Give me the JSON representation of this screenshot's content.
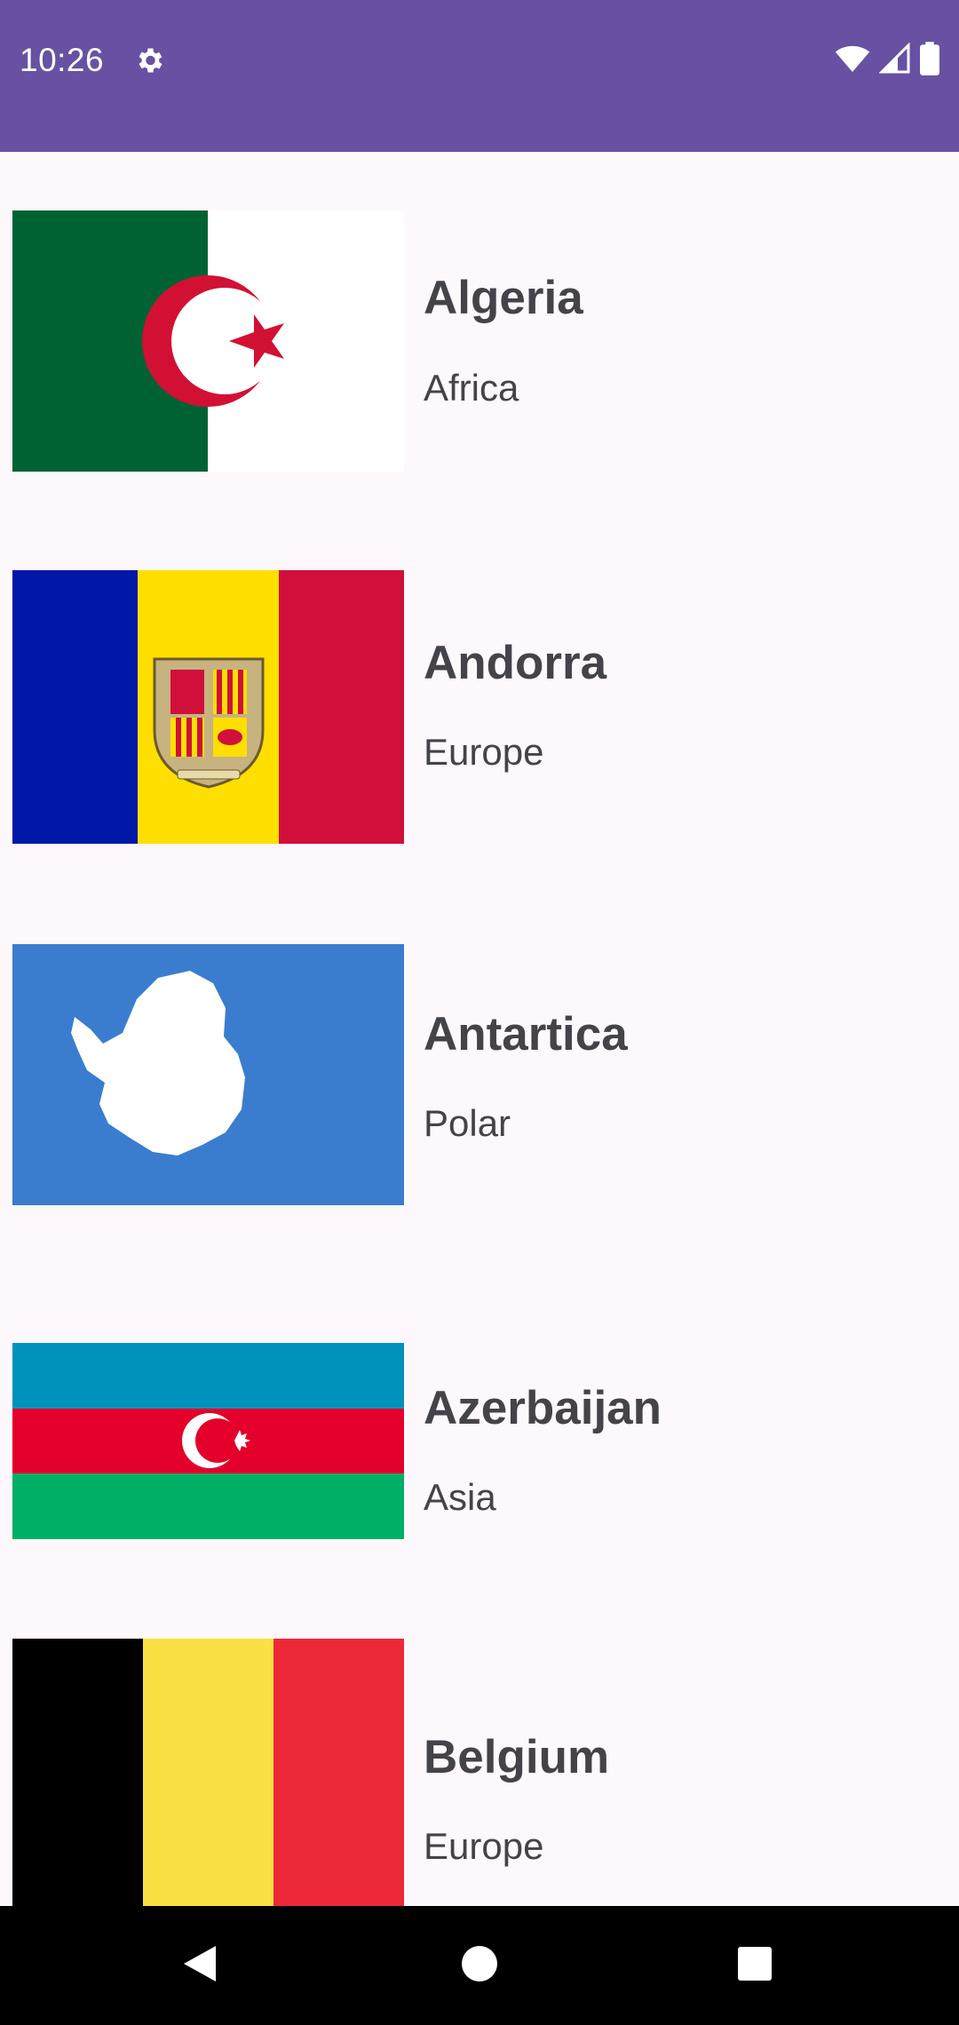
{
  "status_bar": {
    "time": "10:26",
    "background_color": "#6851a3",
    "icons": [
      "gear-icon",
      "wifi-icon",
      "signal-icon",
      "battery-icon"
    ]
  },
  "countries": [
    {
      "name": "Algeria",
      "region": "Africa",
      "flag": "algeria-flag"
    },
    {
      "name": "Andorra",
      "region": "Europe",
      "flag": "andorra-flag"
    },
    {
      "name": "Antartica",
      "region": "Polar",
      "flag": "antarctica-flag"
    },
    {
      "name": "Azerbaijan",
      "region": "Asia",
      "flag": "azerbaijan-flag"
    },
    {
      "name": "Belgium",
      "region": "Europe",
      "flag": "belgium-flag"
    }
  ],
  "nav_bar": {
    "buttons": [
      "back-icon",
      "home-icon",
      "recents-icon"
    ]
  }
}
